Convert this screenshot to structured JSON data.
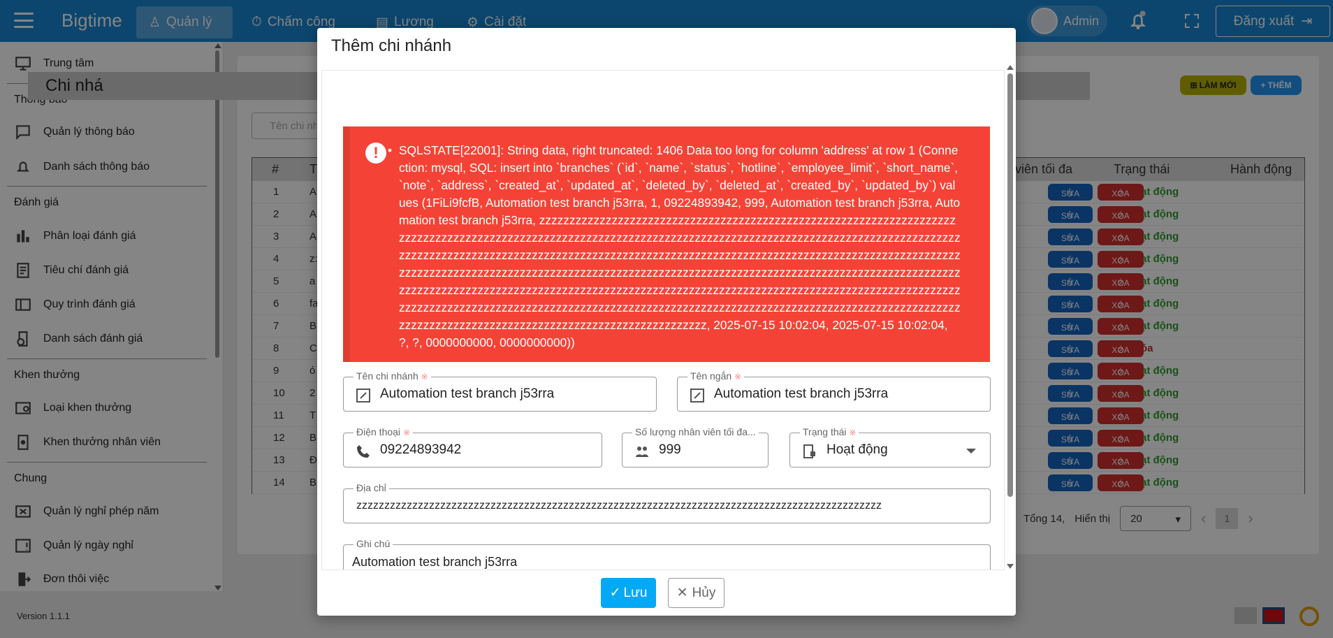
{
  "topbar": {
    "app_name": "Bigtime",
    "nav": [
      {
        "label": "Quản lý"
      },
      {
        "label": "Chấm công"
      },
      {
        "label": "Lương"
      },
      {
        "label": "Cài đặt"
      }
    ],
    "user": "Admin",
    "logout": "Đăng xuất"
  },
  "sidebar": {
    "center": "Trung tâm",
    "notifications_title": "Thông báo",
    "notification_manage": "Quản lý thông báo",
    "notification_list": "Danh sách thông báo",
    "evaluation_title": "Đánh giá",
    "evaluation_type": "Phân loại đánh giá",
    "evaluation_criteria": "Tiêu chí đánh giá",
    "evaluation_process": "Quy trình đánh giá",
    "evaluation_list": "Danh sách đánh giá",
    "reward_title": "Khen thưởng",
    "reward_type": "Loại khen thưởng",
    "employee_reward": "Khen thưởng nhân viên",
    "common_title": "Chung",
    "annual_leave": "Quản lý nghỉ phép năm",
    "holidays": "Quản lý ngày nghỉ",
    "resignation": "Đơn thôi việc",
    "version": "Version 1.1.1"
  },
  "page": {
    "title": "Chi nhá",
    "refresh": "LÀM MỚI",
    "add": "+ THÊM",
    "search_placeholder": "Tên chi nh",
    "headers": {
      "index": "#",
      "name": "T",
      "limit": "viên tối đa",
      "status": "Trạng thái",
      "actions": "Hành động"
    },
    "rows": [
      {
        "i": "1",
        "c": "A",
        "s": "Hoạt động"
      },
      {
        "i": "2",
        "c": "A",
        "s": "Hoạt động"
      },
      {
        "i": "3",
        "c": "A",
        "s": "Hoạt động"
      },
      {
        "i": "4",
        "c": "z:",
        "s": "Hoạt động"
      },
      {
        "i": "5",
        "c": "a",
        "s": "Hoạt động"
      },
      {
        "i": "6",
        "c": "fa",
        "s": "Hoạt động"
      },
      {
        "i": "7",
        "c": "B",
        "s": "Hoạt động"
      },
      {
        "i": "8",
        "c": "C",
        "s": "Khóa"
      },
      {
        "i": "9",
        "c": "ó",
        "s": "Hoạt động"
      },
      {
        "i": "10",
        "c": "2",
        "s": "Hoạt động"
      },
      {
        "i": "11",
        "c": "T",
        "s": "Hoạt động"
      },
      {
        "i": "12",
        "c": "B",
        "s": "Hoạt động"
      },
      {
        "i": "13",
        "c": "Đ",
        "s": "Hoạt động"
      },
      {
        "i": "14",
        "c": "B",
        "s": "Hoạt động"
      }
    ],
    "edit_label": "SỬA",
    "delete_label": "XÓA",
    "total": "Tổng 14,",
    "show": "Hiển thị",
    "page_size": "20",
    "current_page": "1"
  },
  "modal": {
    "title": "Thêm chi nhánh",
    "error": "SQLSTATE[22001]: String data, right truncated: 1406 Data too long for column 'address' at row 1 (Connection: mysql, SQL: insert into `branches` (`id`, `name`, `status`, `hotline`, `employee_limit`, `short_name`, `note`, `address`, `created_at`, `updated_at`, `deleted_by`, `deleted_at`, `created_by`, `updated_by`) values (1FiLi9fcfB, Automation test branch j53rra, 1, 09224893942, 999, Automation test branch j53rra, Automation test branch j53rra, zzzzzzzzzzzzzzzzzzzzzzzzzzzzzzzzzzzzzzzzzzzzzzzzzzzzzzzzzzzzzzzzzzzzzzzzzzzzzzzzzzzzzzzzzzzzzzzzzzzzzzzzzzzzzzzzzzzzzzzzzzzzzzzzzzzzzzzzzzzzzzzzzzzzzzzzzzzzzzzzzzzzzzzzzzzzzzzzzzzzzzzzzzzzzzzzzzzzzzzzzzzzzzzzzzzzzzzzzzzzzzzzzzzzzzzzzzzzzzzzzzzzzzzzzzzzzzzzzzzzzzzzzzzzzzzzzzzzzzzzzzzzzzzzzzzzzzzzzzzzzzzzzzzzzzzzzzzzzzzzzzzzzzzzzzzzzzzzzzzzzzzzzzzzzzzzzzzzzzzzzzzzzzzzzzzzzzzzzzzzzzzzzzzzzzzzzzzzzzzzzzzzzzzzzzzzzzzzzzzzzzzzzzzzzzzzzzzzzzzzzzzzzzzzzzzzzzzzzzzzzzzzzzzzzzzzzzzzzzzzzzzzzzzzzzzzzzzzzzzzzzzzzzzzzzzzzzzzzzzzzzzzzzzzzzzzzzzzzzzzzzzzzzzzzzzzzzzzzzzzzzzzzzzzzzzzzzzzzzzzzzzzz, 2025-07-15 10:02:04, 2025-07-15 10:02:04, ?, ?, 0000000000, 0000000000))",
    "branch_name_label": "Tên chi nhánh",
    "branch_name": "Automation test branch j53rra",
    "short_name_label": "Tên ngắn",
    "short_name": "Automation test branch j53rra",
    "phone_label": "Điện thoại",
    "phone": "09224893942",
    "limit_label": "Số lượng nhân viên tối đa...",
    "limit": "999",
    "status_label": "Trạng thái",
    "status": "Hoạt động",
    "address_label": "Địa chỉ",
    "address": "zzzzzzzzzzzzzzzzzzzzzzzzzzzzzzzzzzzzzzzzzzzzzzzzzzzzzzzzzzzzzzzzzzzzzzzzzzzzzzzzzzzzzzzzzzzzzz",
    "note_label": "Ghi chú",
    "note": "Automation test branch j53rra",
    "save": "Lưu",
    "cancel": "Hủy"
  },
  "colors": {
    "primary": "#1787d3",
    "error": "#f44336",
    "active": "#2f9b2f",
    "locked": "#bd2f2f"
  }
}
